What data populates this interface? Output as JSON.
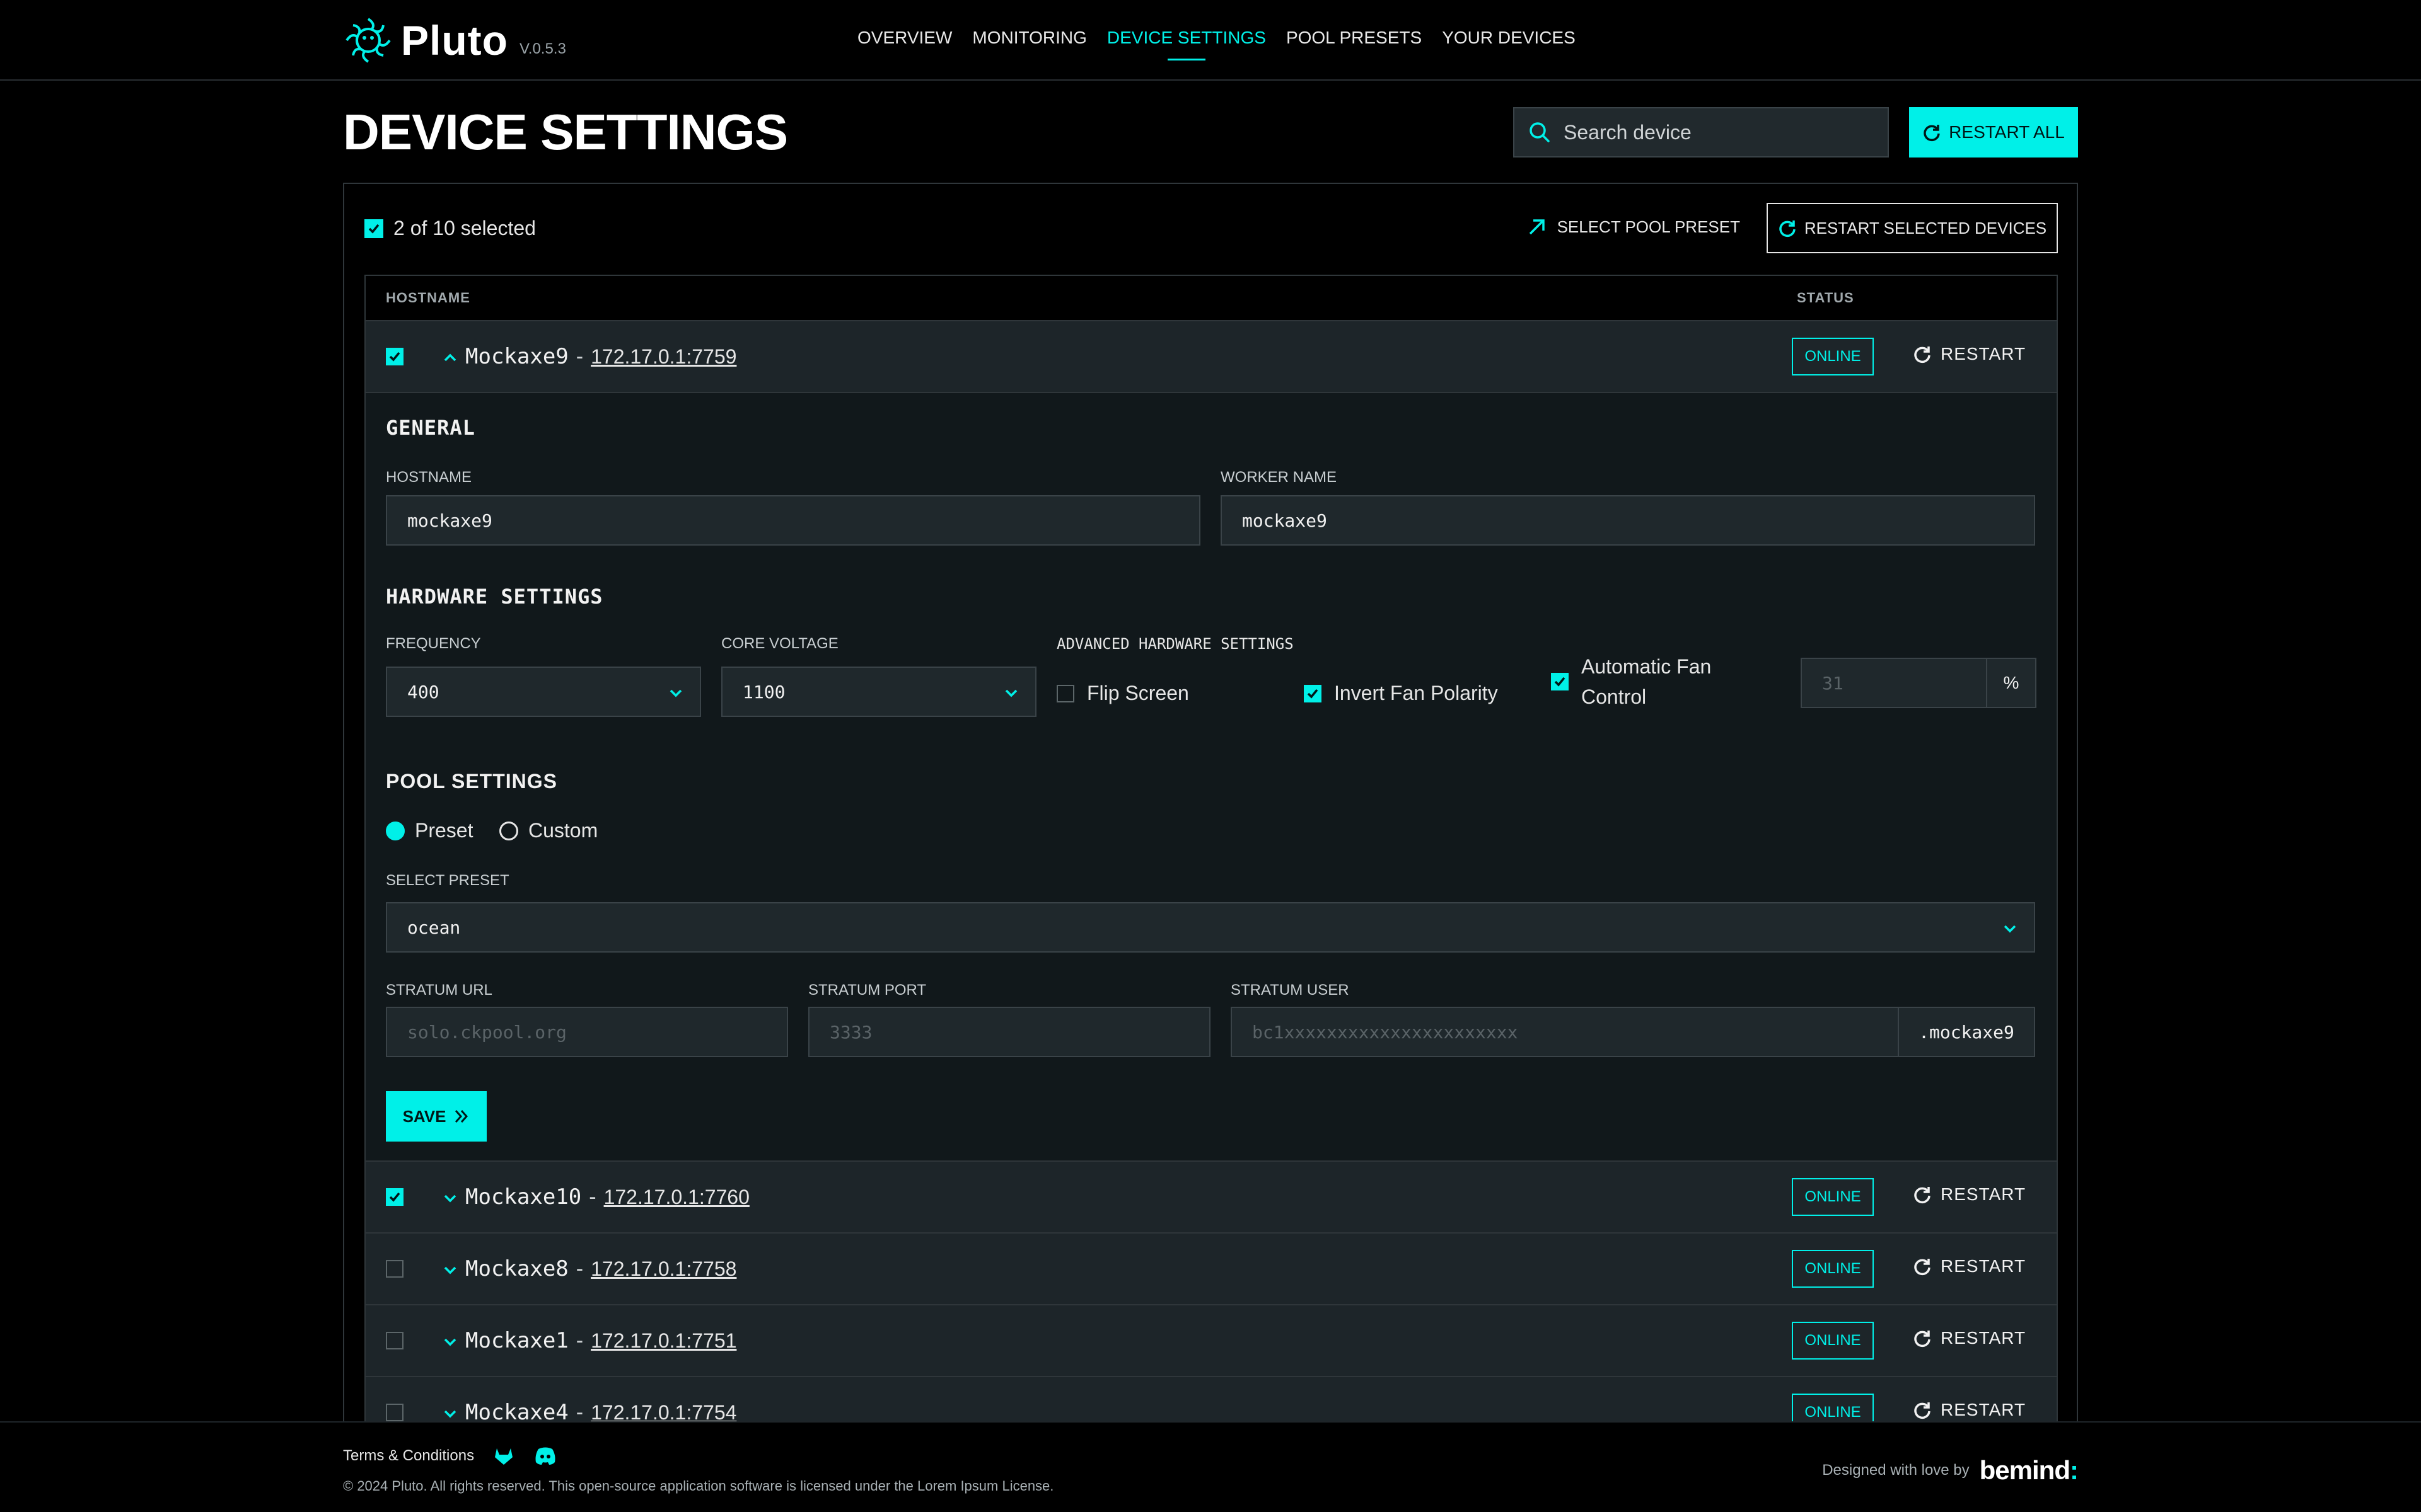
{
  "app": {
    "name": "Pluto",
    "version": "V.0.5.3"
  },
  "nav": {
    "items": [
      {
        "label": "OVERVIEW",
        "active": false
      },
      {
        "label": "MONITORING",
        "active": false
      },
      {
        "label": "DEVICE SETTINGS",
        "active": true
      },
      {
        "label": "POOL PRESETS",
        "active": false
      },
      {
        "label": "YOUR DEVICES",
        "active": false
      }
    ]
  },
  "header": {
    "title": "DEVICE SETTINGS",
    "search_placeholder": "Search device",
    "restart_all_label": "RESTART ALL"
  },
  "selection": {
    "count_text": "2 of 10 selected",
    "select_pool_preset_label": "SELECT POOL PRESET",
    "restart_selected_label": "RESTART SELECTED DEVICES"
  },
  "table": {
    "col_hostname": "HOSTNAME",
    "col_status": "STATUS"
  },
  "devices": [
    {
      "name": "Mockaxe9",
      "ip": "172.17.0.1:7759",
      "status": "ONLINE",
      "restart": "RESTART",
      "checked": true,
      "expanded": true
    },
    {
      "name": "Mockaxe10",
      "ip": "172.17.0.1:7760",
      "status": "ONLINE",
      "restart": "RESTART",
      "checked": true,
      "expanded": false
    },
    {
      "name": "Mockaxe8",
      "ip": "172.17.0.1:7758",
      "status": "ONLINE",
      "restart": "RESTART",
      "checked": false,
      "expanded": false
    },
    {
      "name": "Mockaxe1",
      "ip": "172.17.0.1:7751",
      "status": "ONLINE",
      "restart": "RESTART",
      "checked": false,
      "expanded": false
    },
    {
      "name": "Mockaxe4",
      "ip": "172.17.0.1:7754",
      "status": "ONLINE",
      "restart": "RESTART",
      "checked": false,
      "expanded": false
    }
  ],
  "details": {
    "general_title": "GENERAL",
    "hostname_label": "HOSTNAME",
    "hostname_value": "mockaxe9",
    "worker_label": "WORKER NAME",
    "worker_value": "mockaxe9",
    "hardware_title": "HARDWARE SETTINGS",
    "frequency_label": "FREQUENCY",
    "frequency_value": "400",
    "voltage_label": "CORE VOLTAGE",
    "voltage_value": "1100",
    "advanced_label": "ADVANCED HARDWARE SETTINGS",
    "flip_screen_label": "Flip Screen",
    "flip_screen_checked": false,
    "invert_fan_label": "Invert Fan Polarity",
    "invert_fan_checked": true,
    "auto_fan_label_line1": "Automatic Fan",
    "auto_fan_label_line2": "Control",
    "auto_fan_checked": true,
    "fan_speed_placeholder": "31",
    "fan_speed_unit": "%",
    "pool_title": "POOL SETTINGS",
    "radio_preset_label": "Preset",
    "radio_custom_label": "Custom",
    "radio_selected": "Preset",
    "select_preset_label": "SELECT PRESET",
    "select_preset_value": "ocean",
    "stratum_url_label": "STRATUM URL",
    "stratum_url_placeholder": "solo.ckpool.org",
    "stratum_port_label": "STRATUM PORT",
    "stratum_port_placeholder": "3333",
    "stratum_user_label": "STRATUM USER",
    "stratum_user_placeholder": "bc1xxxxxxxxxxxxxxxxxxxxxx",
    "stratum_user_suffix": ".mockaxe9",
    "save_label": "SAVE"
  },
  "footer": {
    "terms": "Terms & Conditions",
    "copyright": "© 2024 Pluto. All rights reserved. This open-source application software is licensed under the Lorem Ipsum License.",
    "designed_by": "Designed with love by",
    "brand": "bemind",
    "brand_suffix": ":"
  },
  "colors": {
    "accent": "#00f0e8",
    "background": "#000000",
    "panel": "#11181b",
    "row": "#1d2529"
  }
}
